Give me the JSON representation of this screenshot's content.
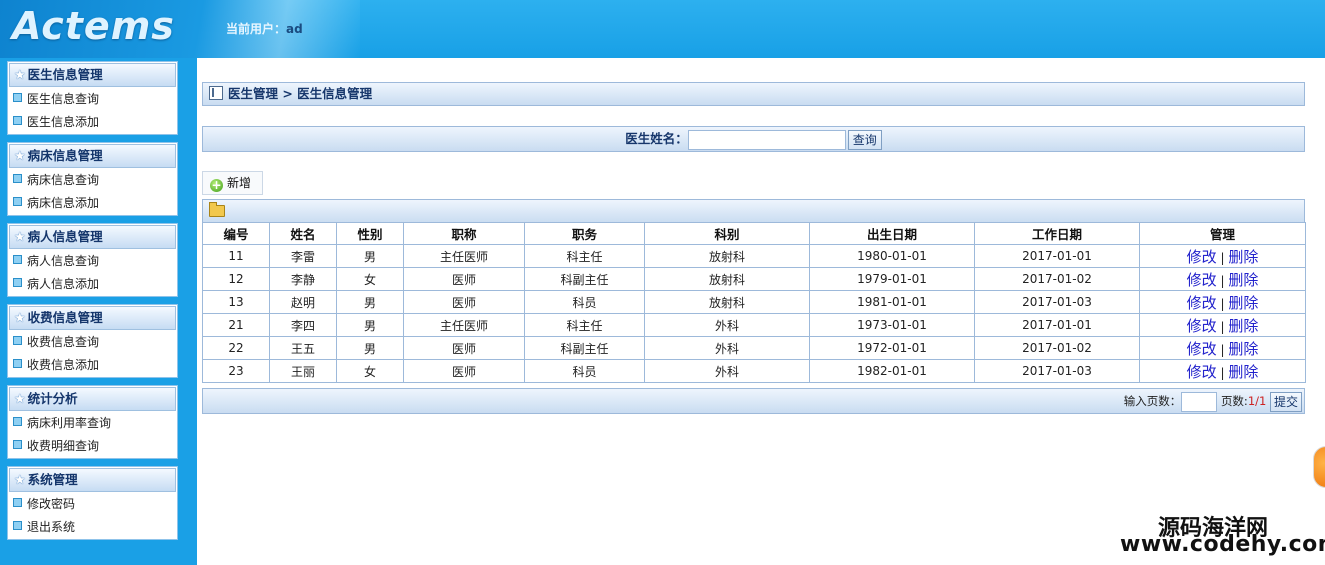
{
  "header": {
    "logo": "Actems",
    "current_user_label": "当前用户：",
    "current_user": "ad"
  },
  "sidebar": {
    "groups": [
      {
        "title": "医生信息管理",
        "items": [
          "医生信息查询",
          "医生信息添加"
        ]
      },
      {
        "title": "病床信息管理",
        "items": [
          "病床信息查询",
          "病床信息添加"
        ]
      },
      {
        "title": "病人信息管理",
        "items": [
          "病人信息查询",
          "病人信息添加"
        ]
      },
      {
        "title": "收费信息管理",
        "items": [
          "收费信息查询",
          "收费信息添加"
        ]
      },
      {
        "title": "统计分析",
        "items": [
          "病床利用率查询",
          "收费明细查询"
        ]
      },
      {
        "title": "系统管理",
        "items": [
          "修改密码",
          "退出系统"
        ]
      }
    ]
  },
  "breadcrumb": "医生管理 > 医生信息管理",
  "search": {
    "label": "医生姓名：",
    "value": "",
    "button": "查询"
  },
  "add_button": "新增",
  "table": {
    "columns": [
      "编号",
      "姓名",
      "性别",
      "职称",
      "职务",
      "科别",
      "出生日期",
      "工作日期",
      "管理"
    ],
    "rows": [
      [
        "11",
        "李雷",
        "男",
        "主任医师",
        "科主任",
        "放射科",
        "1980-01-01",
        "2017-01-01"
      ],
      [
        "12",
        "李静",
        "女",
        "医师",
        "科副主任",
        "放射科",
        "1979-01-01",
        "2017-01-02"
      ],
      [
        "13",
        "赵明",
        "男",
        "医师",
        "科员",
        "放射科",
        "1981-01-01",
        "2017-01-03"
      ],
      [
        "21",
        "李四",
        "男",
        "主任医师",
        "科主任",
        "外科",
        "1973-01-01",
        "2017-01-01"
      ],
      [
        "22",
        "王五",
        "男",
        "医师",
        "科副主任",
        "外科",
        "1972-01-01",
        "2017-01-02"
      ],
      [
        "23",
        "王丽",
        "女",
        "医师",
        "科员",
        "外科",
        "1982-01-01",
        "2017-01-03"
      ]
    ],
    "edit_label": "修改",
    "delete_label": "删除",
    "separator": "|"
  },
  "pager": {
    "input_label": "输入页数：",
    "page_label": "页数:",
    "page_value": "1/1",
    "submit": "提交"
  },
  "watermark": {
    "line1": "源码海洋网",
    "line2": "www.codehy.com"
  }
}
